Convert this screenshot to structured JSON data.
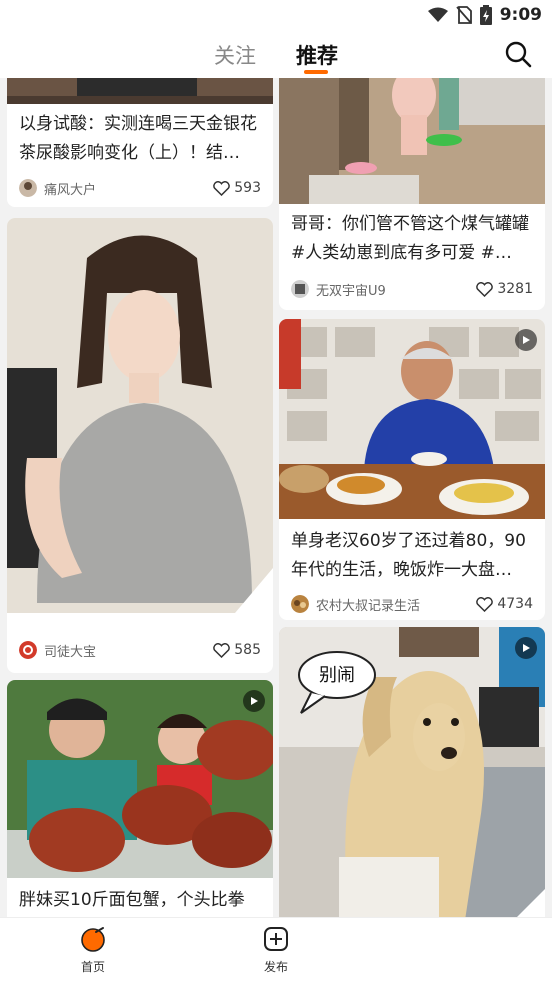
{
  "status_bar": {
    "time": "9:09",
    "icons": [
      "wifi-icon",
      "no-sim-icon",
      "battery-charging-icon"
    ]
  },
  "top_nav": {
    "tabs": [
      "关注",
      "推荐"
    ],
    "active_tab": "推荐",
    "search_icon": "search-icon"
  },
  "cards": [
    {
      "title": "以身试酸：实测连喝三天金银花茶尿酸影响变化（上）！结…",
      "author": "痛风大户",
      "likes": "593"
    },
    {
      "title": "",
      "author": "司徒大宝",
      "likes": "585"
    },
    {
      "title": "胖妹买10斤面包蟹，个头比拳",
      "author": "",
      "likes": "",
      "has_play": true
    },
    {
      "title": "哥哥：你们管不管这个煤气罐罐#人类幼崽到底有多可爱 #…",
      "author": "无双宇宙U9",
      "likes": "3281"
    },
    {
      "title": "单身老汉60岁了还过着80，90年代的生活，晚饭炸一大盘…",
      "author": "农村大叔记录生活",
      "likes": "4734",
      "has_play": true
    },
    {
      "title": "",
      "author": "",
      "likes": "",
      "has_play": true,
      "bubble_text": "别闹"
    }
  ],
  "bottom_nav": {
    "items": [
      {
        "label": "首页",
        "icon": "home-icon"
      },
      {
        "label": "发布",
        "icon": "publish-icon"
      }
    ]
  },
  "colors": {
    "accent": "#ff6a00",
    "background": "#f2f2f2"
  }
}
